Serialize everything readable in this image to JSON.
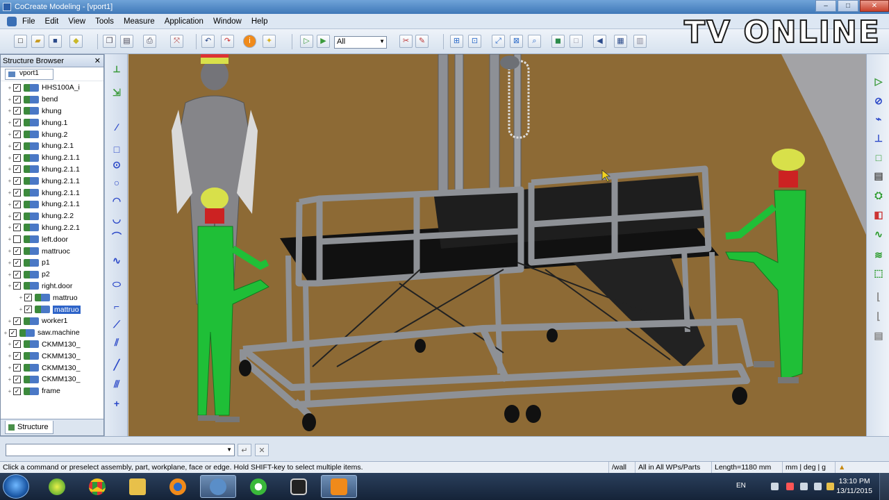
{
  "window": {
    "title": "CoCreate Modeling - [vport1]",
    "controls": {
      "minimize": "–",
      "maximize": "□",
      "close": "✕"
    }
  },
  "watermark": "TV ONLINE",
  "menu": [
    "File",
    "Edit",
    "View",
    "Tools",
    "Measure",
    "Application",
    "Window",
    "Help"
  ],
  "toolbar": {
    "filter_value": "All",
    "icons": [
      "new-icon",
      "open-icon",
      "save-icon",
      "cube-icon",
      "copy-icon",
      "paste-icon",
      "print-icon",
      "transform-icon",
      "undo-icon",
      "redo-icon",
      "info-icon",
      "light-bulb-icon",
      "select-icon",
      "select-plus-icon",
      "filter-select",
      "delete-icon",
      "rename-icon",
      "fit-icon",
      "zoom-icon",
      "fit-all-icon",
      "zoom-box-icon",
      "search-zoom-icon",
      "shaded-icon",
      "wireframe-icon",
      "prev-view-icon",
      "stack-icon",
      "grid-icon"
    ]
  },
  "browser": {
    "title": "Structure Browser",
    "close": "✕",
    "viewport": "vport1",
    "tab": "Structure",
    "items": [
      {
        "label": "HHS100A_i",
        "checked": true
      },
      {
        "label": "bend",
        "checked": true
      },
      {
        "label": "khung",
        "checked": true
      },
      {
        "label": "khung.1",
        "checked": true
      },
      {
        "label": "khung.2",
        "checked": true
      },
      {
        "label": "khung.2.1",
        "checked": true
      },
      {
        "label": "khung.2.1.1",
        "checked": true
      },
      {
        "label": "khung.2.1.1",
        "checked": true
      },
      {
        "label": "khung.2.1.1",
        "checked": true
      },
      {
        "label": "khung.2.1.1",
        "checked": true
      },
      {
        "label": "khung.2.1.1",
        "checked": true
      },
      {
        "label": "khung.2.2",
        "checked": true
      },
      {
        "label": "khung.2.2.1",
        "checked": true
      },
      {
        "label": "left.door",
        "checked": false
      },
      {
        "label": "mattruoc",
        "checked": true
      },
      {
        "label": "p1",
        "checked": true
      },
      {
        "label": "p2",
        "checked": true
      },
      {
        "label": "right.door",
        "checked": true
      },
      {
        "label": "mattruo",
        "checked": true,
        "indent": true
      },
      {
        "label": "mattruo",
        "checked": true,
        "indent": true,
        "selected": true
      },
      {
        "label": "worker1",
        "checked": true
      },
      {
        "label": "saw.machine",
        "checked": true,
        "outdent": true
      },
      {
        "label": "CKMM130_",
        "checked": true
      },
      {
        "label": "CKMM130_",
        "checked": true
      },
      {
        "label": "CKMM130_",
        "checked": true
      },
      {
        "label": "CKMM130_",
        "checked": true
      },
      {
        "label": "frame",
        "checked": true
      }
    ]
  },
  "command": {
    "input_value": "",
    "enter": "↵",
    "cancel": "✕"
  },
  "status": {
    "message": "Click a command or preselect assembly, part, workplane, face or edge. Hold SHIFT-key to select multiple items.",
    "workplane": "/wall",
    "scope": "All in All WPs/Parts",
    "length": "Length=1180 mm",
    "units": "mm | deg | g"
  },
  "taskbar": {
    "apps": [
      "media-player-icon",
      "chrome-icon",
      "file-explorer-icon",
      "firefox-icon",
      "settings-icon",
      "green-app-icon",
      "camera-icon",
      "video-recorder-icon"
    ],
    "lang": "EN",
    "time": "13:10 PM",
    "date": "13/11/2015"
  },
  "colors": {
    "viewport_bg": "#8d6a35",
    "frame_metal": "#8e9196",
    "worker_green": "#1fbf37",
    "mannequin": "#7d7d80",
    "helmet": "#d8e04a"
  }
}
